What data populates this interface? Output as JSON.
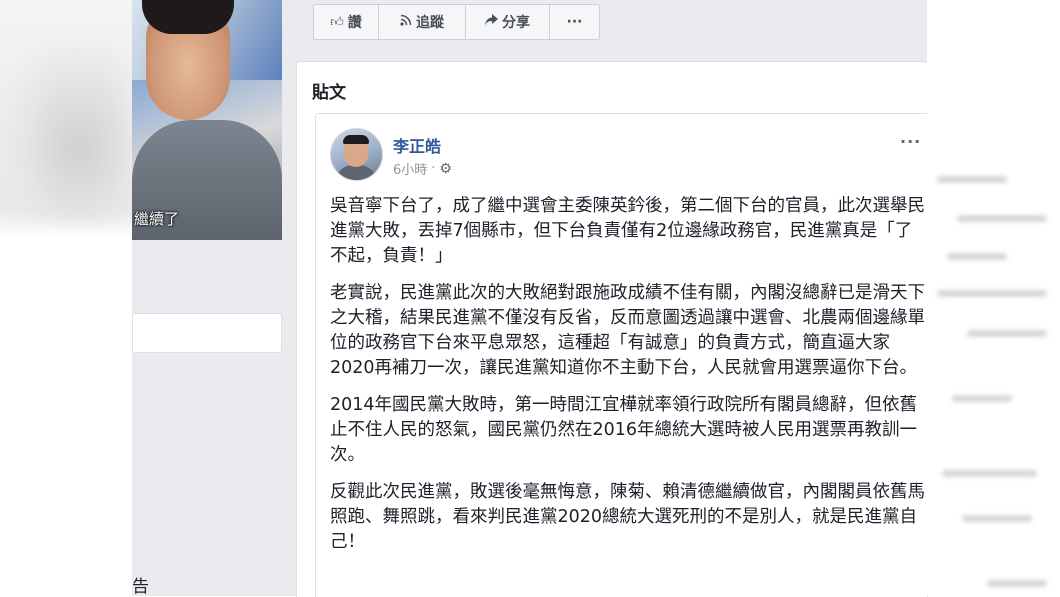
{
  "profile": {
    "photo_caption": "繼續了"
  },
  "sidebar": {
    "bottom_text": "告"
  },
  "action_bar": {
    "like_icon": "thumbs-up-icon",
    "like_label": "讚",
    "follow_icon": "rss-icon",
    "follow_label": "追蹤",
    "share_icon": "share-arrow-icon",
    "share_label": "分享",
    "more_label": "···"
  },
  "posts": {
    "heading": "貼文",
    "post": {
      "author": "李正皓",
      "time": "6小時",
      "separator": "·",
      "privacy_icon": "gear-icon",
      "more_label": "···",
      "paragraphs": [
        "吳音寧下台了，成了繼中選會主委陳英鈐後，第二個下台的官員，此次選舉民進黨大敗，丟掉7個縣市，但下台負責僅有2位邊緣政務官，民進黨真是「了不起，負責！」",
        "老實說，民進黨此次的大敗絕對跟施政成績不佳有關，內閣沒總辭已是滑天下之大稽，結果民進黨不僅沒有反省，反而意圖透過讓中選會、北農兩個邊緣單位的政務官下台來平息眾怒，這種超「有誠意」的負責方式，簡直逼大家2020再補刀一次，讓民進黨知道你不主動下台，人民就會用選票逼你下台。",
        "2014年國民黨大敗時，第一時間江宜樺就率領行政院所有閣員總辭，但依舊止不住人民的怒氣，國民黨仍然在2016年總統大選時被人民用選票再教訓一次。",
        "反觀此次民進黨，敗選後毫無悔意，陳菊、賴清德繼續做官，內閣閣員依舊馬照跑、舞照跳，看來判民進黨2020總統大選死刑的不是別人，就是民進黨自己！"
      ]
    }
  }
}
